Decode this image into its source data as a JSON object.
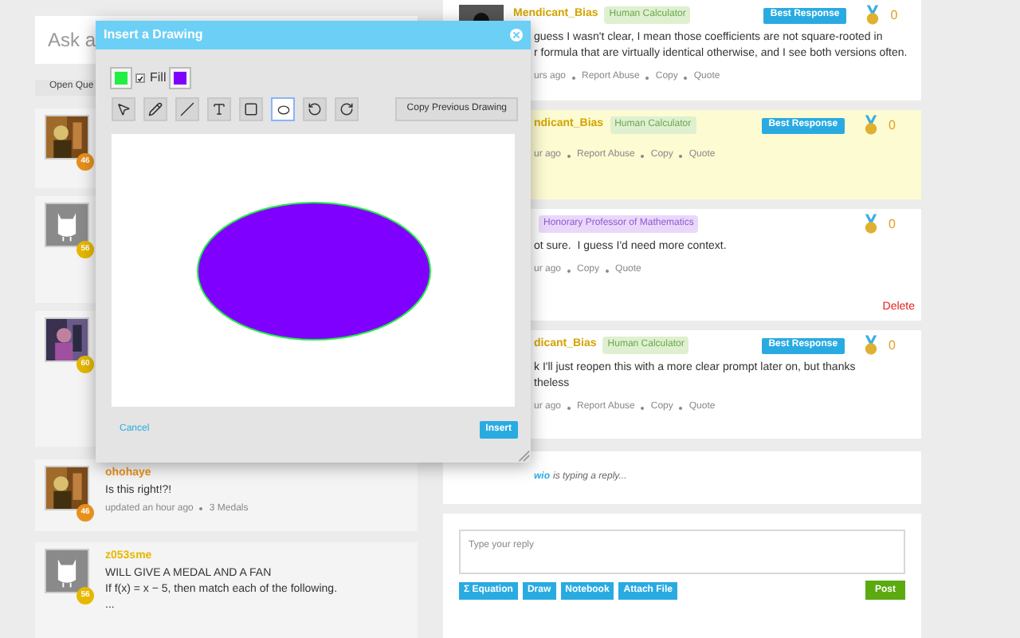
{
  "search": {
    "placeholder": "Ask a"
  },
  "filter_tab": {
    "label": "Open Que"
  },
  "questions": [
    {
      "score": "46",
      "color": "#e8901c"
    },
    {
      "kind": "owl",
      "score": "56",
      "color": "#e6b800"
    },
    {
      "kind": "photo2",
      "score": "60",
      "color": "#e6b800"
    },
    {
      "score": "46",
      "color": "#e8901c",
      "name": "ohohaye",
      "lines": [
        "Is this right!?!"
      ],
      "meta": [
        "updated an hour ago",
        "3 Medals"
      ]
    },
    {
      "kind": "owl",
      "score": "56",
      "color": "#e6b800",
      "name": "z053sme",
      "lines": [
        "WILL GIVE A MEDAL AND A FAN",
        "If f(x) = x − 5, then match each of the following.",
        "..."
      ]
    }
  ],
  "replies": [
    {
      "author": "Mendicant_Bias",
      "tag": "Human Calculator",
      "kind": "calculator",
      "highlighted": false,
      "avatar": {
        "kind": "picture"
      },
      "best": "Best Response",
      "medals": "0",
      "lines": [
        "guess I wasn't clear, I mean those coefficients are not square-rooted in",
        "r formula that are virtually identical otherwise, and I see both versions often."
      ],
      "meta": [
        "urs ago",
        "Report Abuse",
        "Copy",
        "Quote"
      ]
    },
    {
      "author": "ndicant_Bias",
      "tag": "Human Calculator",
      "kind": "calculator",
      "highlighted": true,
      "best": "Best Response",
      "medals": "0",
      "meta": [
        "ur ago",
        "Report Abuse",
        "Copy",
        "Quote"
      ]
    },
    {
      "tag": "Honorary Professor of Mathematics",
      "kind": "professor",
      "highlighted": false,
      "medals": "0",
      "lines": [
        "ot sure.  I guess I'd need more context."
      ],
      "meta": [
        "ur ago",
        "Copy",
        "Quote"
      ],
      "delete": "Delete"
    },
    {
      "author": "dicant_Bias",
      "tag": "Human Calculator",
      "kind": "calculator",
      "highlighted": false,
      "best": "Best Response",
      "medals": "0",
      "lines": [
        "k I'll just reopen this with a more clear prompt later on, but thanks",
        "theless"
      ],
      "meta": [
        "ur ago",
        "Report Abuse",
        "Copy",
        "Quote"
      ]
    }
  ],
  "typing": {
    "user": "wio",
    "text": "is typing a reply..."
  },
  "composer": {
    "placeholder": "Type your reply",
    "tools": [
      {
        "kind": "equation",
        "icon": "Σ",
        "label": "Equation"
      },
      {
        "kind": "plain",
        "label": "Draw"
      },
      {
        "kind": "plain",
        "label": "Notebook"
      },
      {
        "kind": "plain",
        "label": "Attach File"
      }
    ],
    "post": "Post"
  },
  "dialog": {
    "title": "Insert a Drawing",
    "stroke": {
      "color": "#22ee44"
    },
    "fill": {
      "label": "Fill",
      "checked": true,
      "color": "#8000ff"
    },
    "tools": [
      {
        "kind": "pointer",
        "selected": false
      },
      {
        "kind": "pen",
        "selected": false
      },
      {
        "kind": "line",
        "selected": false
      },
      {
        "kind": "text",
        "selected": false
      },
      {
        "kind": "rect",
        "selected": false
      },
      {
        "kind": "ellipse",
        "selected": true
      },
      {
        "kind": "undo",
        "selected": false
      },
      {
        "kind": "redo",
        "selected": false
      }
    ],
    "copy_button": "Copy Previous Drawing",
    "cancel": "Cancel",
    "insert": "Insert"
  }
}
